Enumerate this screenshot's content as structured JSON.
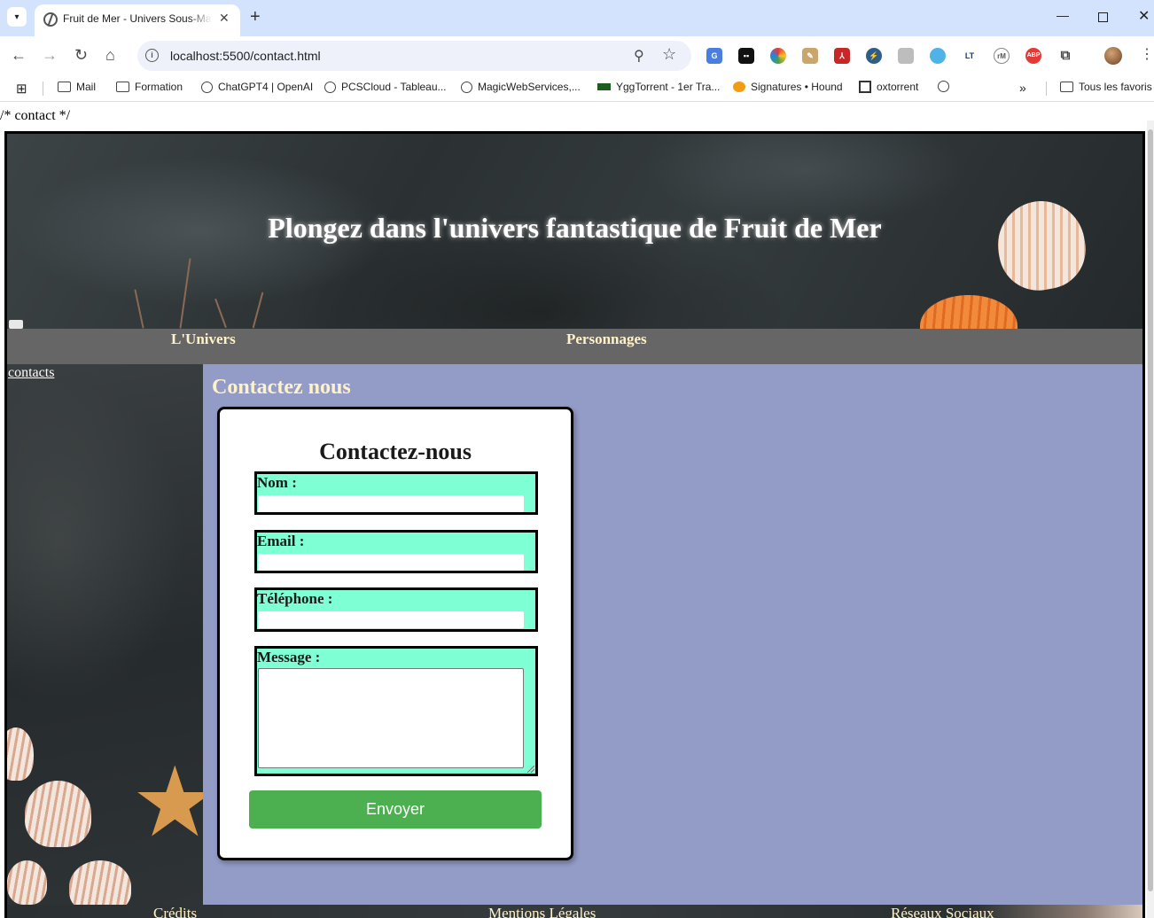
{
  "browser": {
    "tab_title": "Fruit de Mer - Univers Sous-Marin",
    "tab_close": "✕",
    "new_tab": "+",
    "url": "localhost:5500/contact.html",
    "bookmarks": [
      {
        "label": "Mail",
        "icon": "folder-icon"
      },
      {
        "label": "Formation",
        "icon": "folder-icon"
      },
      {
        "label": "ChatGPT4 | OpenAI",
        "icon": "openai-icon"
      },
      {
        "label": "PCSCloud - Tableau...",
        "icon": "globe-icon"
      },
      {
        "label": "MagicWebServices,...",
        "icon": "globe-icon"
      },
      {
        "label": "YggTorrent - 1er Tra...",
        "icon": "ygg-icon"
      },
      {
        "label": "Signatures • Hound",
        "icon": "hound-icon"
      },
      {
        "label": "oxtorrent",
        "icon": "oxtorrent-icon"
      }
    ],
    "bookmarks_overflow": "»",
    "all_bookmarks": "Tous les favoris",
    "extensions": [
      "translate-icon",
      "tab-icon",
      "color-icon",
      "note-icon",
      "pdf-icon",
      "speed-icon",
      "blank-icon",
      "cloud-icon",
      "lt-icon",
      "rm-icon",
      "adblock-icon",
      "puzzle-icon"
    ],
    "ext_labels": {
      "lt": "LT",
      "rm": "rM",
      "abp": "ABP"
    }
  },
  "page": {
    "css_leak": "/* contact */",
    "site_title": "Plongez dans l'univers fantastique de Fruit de Mer",
    "nav": {
      "univers": "L'Univers",
      "personnages": "Personnages"
    },
    "sidebar_link": "contacts",
    "main_heading": "Contactez nous",
    "form": {
      "title": "Contactez-nous",
      "nom_label": "Nom :",
      "email_label": "Email :",
      "tel_label": "Téléphone :",
      "message_label": "Message :",
      "nom_value": "",
      "email_value": "",
      "tel_value": "",
      "message_value": "",
      "submit": "Envoyer"
    },
    "footer": {
      "credits": "Crédits",
      "mentions": "Mentions Légales",
      "reseaux": "Réseaux Sociaux"
    }
  },
  "colors": {
    "main_bg": "#939bc7",
    "field_bg": "#7fffd4",
    "submit_bg": "#4caf50",
    "nav_bg": "#666666",
    "link_color": "#fff2c8"
  }
}
